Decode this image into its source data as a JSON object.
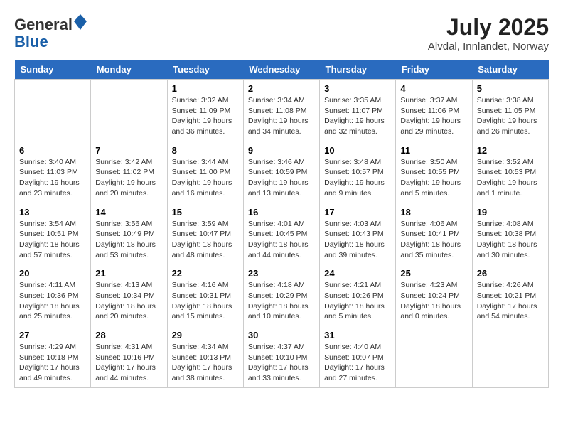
{
  "header": {
    "logo_line1": "General",
    "logo_line2": "Blue",
    "month_title": "July 2025",
    "location": "Alvdal, Innlandet, Norway"
  },
  "days_of_week": [
    "Sunday",
    "Monday",
    "Tuesday",
    "Wednesday",
    "Thursday",
    "Friday",
    "Saturday"
  ],
  "weeks": [
    [
      {
        "day": "",
        "sunrise": "",
        "sunset": "",
        "daylight": ""
      },
      {
        "day": "",
        "sunrise": "",
        "sunset": "",
        "daylight": ""
      },
      {
        "day": "1",
        "sunrise": "Sunrise: 3:32 AM",
        "sunset": "Sunset: 11:09 PM",
        "daylight": "Daylight: 19 hours and 36 minutes."
      },
      {
        "day": "2",
        "sunrise": "Sunrise: 3:34 AM",
        "sunset": "Sunset: 11:08 PM",
        "daylight": "Daylight: 19 hours and 34 minutes."
      },
      {
        "day": "3",
        "sunrise": "Sunrise: 3:35 AM",
        "sunset": "Sunset: 11:07 PM",
        "daylight": "Daylight: 19 hours and 32 minutes."
      },
      {
        "day": "4",
        "sunrise": "Sunrise: 3:37 AM",
        "sunset": "Sunset: 11:06 PM",
        "daylight": "Daylight: 19 hours and 29 minutes."
      },
      {
        "day": "5",
        "sunrise": "Sunrise: 3:38 AM",
        "sunset": "Sunset: 11:05 PM",
        "daylight": "Daylight: 19 hours and 26 minutes."
      }
    ],
    [
      {
        "day": "6",
        "sunrise": "Sunrise: 3:40 AM",
        "sunset": "Sunset: 11:03 PM",
        "daylight": "Daylight: 19 hours and 23 minutes."
      },
      {
        "day": "7",
        "sunrise": "Sunrise: 3:42 AM",
        "sunset": "Sunset: 11:02 PM",
        "daylight": "Daylight: 19 hours and 20 minutes."
      },
      {
        "day": "8",
        "sunrise": "Sunrise: 3:44 AM",
        "sunset": "Sunset: 11:00 PM",
        "daylight": "Daylight: 19 hours and 16 minutes."
      },
      {
        "day": "9",
        "sunrise": "Sunrise: 3:46 AM",
        "sunset": "Sunset: 10:59 PM",
        "daylight": "Daylight: 19 hours and 13 minutes."
      },
      {
        "day": "10",
        "sunrise": "Sunrise: 3:48 AM",
        "sunset": "Sunset: 10:57 PM",
        "daylight": "Daylight: 19 hours and 9 minutes."
      },
      {
        "day": "11",
        "sunrise": "Sunrise: 3:50 AM",
        "sunset": "Sunset: 10:55 PM",
        "daylight": "Daylight: 19 hours and 5 minutes."
      },
      {
        "day": "12",
        "sunrise": "Sunrise: 3:52 AM",
        "sunset": "Sunset: 10:53 PM",
        "daylight": "Daylight: 19 hours and 1 minute."
      }
    ],
    [
      {
        "day": "13",
        "sunrise": "Sunrise: 3:54 AM",
        "sunset": "Sunset: 10:51 PM",
        "daylight": "Daylight: 18 hours and 57 minutes."
      },
      {
        "day": "14",
        "sunrise": "Sunrise: 3:56 AM",
        "sunset": "Sunset: 10:49 PM",
        "daylight": "Daylight: 18 hours and 53 minutes."
      },
      {
        "day": "15",
        "sunrise": "Sunrise: 3:59 AM",
        "sunset": "Sunset: 10:47 PM",
        "daylight": "Daylight: 18 hours and 48 minutes."
      },
      {
        "day": "16",
        "sunrise": "Sunrise: 4:01 AM",
        "sunset": "Sunset: 10:45 PM",
        "daylight": "Daylight: 18 hours and 44 minutes."
      },
      {
        "day": "17",
        "sunrise": "Sunrise: 4:03 AM",
        "sunset": "Sunset: 10:43 PM",
        "daylight": "Daylight: 18 hours and 39 minutes."
      },
      {
        "day": "18",
        "sunrise": "Sunrise: 4:06 AM",
        "sunset": "Sunset: 10:41 PM",
        "daylight": "Daylight: 18 hours and 35 minutes."
      },
      {
        "day": "19",
        "sunrise": "Sunrise: 4:08 AM",
        "sunset": "Sunset: 10:38 PM",
        "daylight": "Daylight: 18 hours and 30 minutes."
      }
    ],
    [
      {
        "day": "20",
        "sunrise": "Sunrise: 4:11 AM",
        "sunset": "Sunset: 10:36 PM",
        "daylight": "Daylight: 18 hours and 25 minutes."
      },
      {
        "day": "21",
        "sunrise": "Sunrise: 4:13 AM",
        "sunset": "Sunset: 10:34 PM",
        "daylight": "Daylight: 18 hours and 20 minutes."
      },
      {
        "day": "22",
        "sunrise": "Sunrise: 4:16 AM",
        "sunset": "Sunset: 10:31 PM",
        "daylight": "Daylight: 18 hours and 15 minutes."
      },
      {
        "day": "23",
        "sunrise": "Sunrise: 4:18 AM",
        "sunset": "Sunset: 10:29 PM",
        "daylight": "Daylight: 18 hours and 10 minutes."
      },
      {
        "day": "24",
        "sunrise": "Sunrise: 4:21 AM",
        "sunset": "Sunset: 10:26 PM",
        "daylight": "Daylight: 18 hours and 5 minutes."
      },
      {
        "day": "25",
        "sunrise": "Sunrise: 4:23 AM",
        "sunset": "Sunset: 10:24 PM",
        "daylight": "Daylight: 18 hours and 0 minutes."
      },
      {
        "day": "26",
        "sunrise": "Sunrise: 4:26 AM",
        "sunset": "Sunset: 10:21 PM",
        "daylight": "Daylight: 17 hours and 54 minutes."
      }
    ],
    [
      {
        "day": "27",
        "sunrise": "Sunrise: 4:29 AM",
        "sunset": "Sunset: 10:18 PM",
        "daylight": "Daylight: 17 hours and 49 minutes."
      },
      {
        "day": "28",
        "sunrise": "Sunrise: 4:31 AM",
        "sunset": "Sunset: 10:16 PM",
        "daylight": "Daylight: 17 hours and 44 minutes."
      },
      {
        "day": "29",
        "sunrise": "Sunrise: 4:34 AM",
        "sunset": "Sunset: 10:13 PM",
        "daylight": "Daylight: 17 hours and 38 minutes."
      },
      {
        "day": "30",
        "sunrise": "Sunrise: 4:37 AM",
        "sunset": "Sunset: 10:10 PM",
        "daylight": "Daylight: 17 hours and 33 minutes."
      },
      {
        "day": "31",
        "sunrise": "Sunrise: 4:40 AM",
        "sunset": "Sunset: 10:07 PM",
        "daylight": "Daylight: 17 hours and 27 minutes."
      },
      {
        "day": "",
        "sunrise": "",
        "sunset": "",
        "daylight": ""
      },
      {
        "day": "",
        "sunrise": "",
        "sunset": "",
        "daylight": ""
      }
    ]
  ]
}
